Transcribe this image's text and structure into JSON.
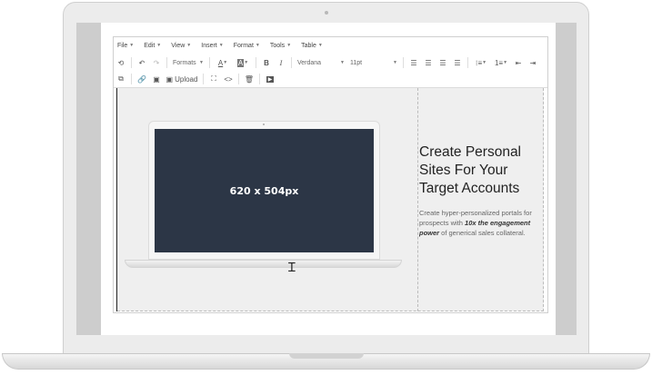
{
  "menubar": {
    "items": [
      "File",
      "Edit",
      "View",
      "Insert",
      "Format",
      "Tools",
      "Table"
    ]
  },
  "toolbar": {
    "formats_label": "Formats",
    "font_family": "Verdana",
    "font_size": "11pt",
    "upload_label": "Upload"
  },
  "mockup": {
    "screen_text": "620 x 504px"
  },
  "content": {
    "headline_lines": [
      "Create Personal",
      "Sites For Your",
      "Target Accounts"
    ],
    "body_prefix": "Create hyper-personalized portals for prospects with ",
    "body_emphasis": "10x the engagement power",
    "body_suffix": " of generical sales collateral."
  },
  "colors": {
    "mock_screen": "#2c3646",
    "content_bg": "#efefef"
  }
}
